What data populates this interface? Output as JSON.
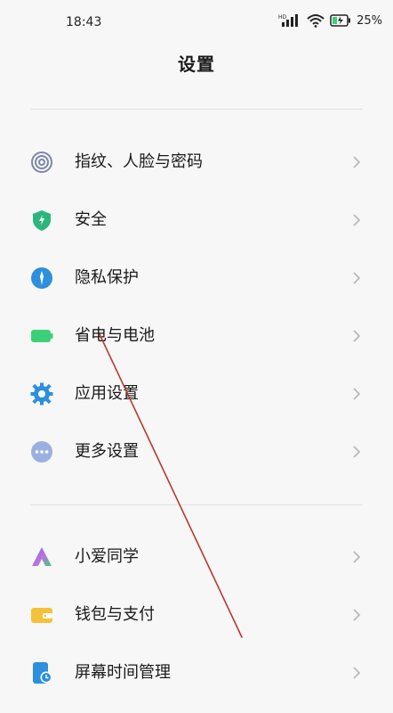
{
  "status_bar": {
    "time": "18:43",
    "battery_percent": "25%",
    "network_badge": "HD"
  },
  "header": {
    "title": "设置"
  },
  "groups": [
    {
      "items": [
        {
          "label": "指纹、人脸与密码",
          "icon": "fingerprint-icon",
          "color": "#7b86a8"
        },
        {
          "label": "安全",
          "icon": "shield-icon",
          "color": "#2db67c"
        },
        {
          "label": "隐私保护",
          "icon": "privacy-icon",
          "color": "#2d8fdd"
        },
        {
          "label": "省电与电池",
          "icon": "battery-icon",
          "color": "#3bcf7a"
        },
        {
          "label": "应用设置",
          "icon": "gear-icon",
          "color": "#2d8fdd"
        },
        {
          "label": "更多设置",
          "icon": "more-icon",
          "color": "#9ab0e0"
        }
      ]
    },
    {
      "items": [
        {
          "label": "小爱同学",
          "icon": "xiaoai-icon",
          "color": "#4c7cf0"
        },
        {
          "label": "钱包与支付",
          "icon": "wallet-icon",
          "color": "#f4c23a"
        },
        {
          "label": "屏幕时间管理",
          "icon": "screen-time-icon",
          "color": "#2d8fdd"
        }
      ]
    }
  ],
  "colors": {
    "chevron": "#b8b8b8",
    "annotation_line": "#b8392e"
  }
}
